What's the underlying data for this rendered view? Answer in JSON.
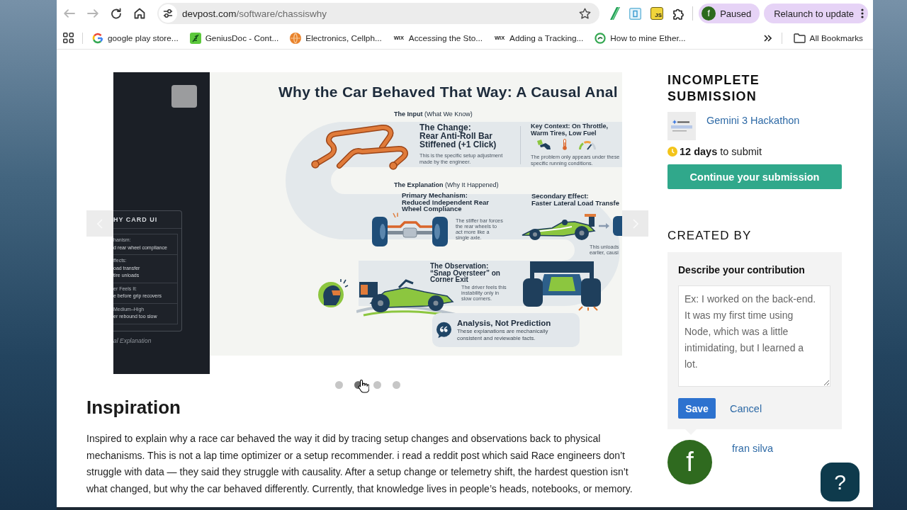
{
  "browser": {
    "nav_buttons": [
      {
        "kind": "back",
        "disabled": true
      },
      {
        "kind": "forward",
        "disabled": true
      },
      {
        "kind": "reload",
        "disabled": false
      },
      {
        "kind": "home",
        "disabled": false
      }
    ],
    "address_bar": {
      "host": "devpost.com",
      "path": "/software/chassiswhy"
    },
    "extensions": [
      {
        "kind": "pen"
      },
      {
        "kind": "frame"
      },
      {
        "kind": "js",
        "label": "JS"
      },
      {
        "kind": "puzzle"
      }
    ],
    "profile": {
      "initial": "f",
      "label": "Paused"
    },
    "update_button": {
      "label": "Relaunch to update"
    },
    "bookmarks": [
      {
        "kind": "google",
        "title": "google play store..."
      },
      {
        "kind": "leaf",
        "title": "GeniusDoc - Cont..."
      },
      {
        "kind": "globe",
        "title": "Electronics, Cellph..."
      },
      {
        "kind": "wix",
        "icon_text": "WIX",
        "title": "Accessing the Sto..."
      },
      {
        "kind": "wix",
        "icon_text": "WIX",
        "title": "Adding a Tracking..."
      },
      {
        "kind": "ring",
        "title": "How to mine Ether..."
      }
    ],
    "all_bookmarks": {
      "label": "All Bookmarks"
    }
  },
  "page": {
    "carousel": {
      "slide": {
        "side_panel": {
          "card_title": "HY CARD UI",
          "sections": [
            {
              "label": "hanism:",
              "lines": [
                "d rear wheel compliance"
              ]
            },
            {
              "label": "ffects:",
              "lines": [
                "oad transfer",
                "tire unloads"
              ]
            },
            {
              "label": "er Feels It:",
              "lines": [
                "e before grip recovers"
              ]
            },
            {
              "label": "Medium–High",
              "lines": [
                "er rebound too slow"
              ]
            }
          ],
          "footer": "al Explanation"
        },
        "infographic": {
          "title": "Why the Car Behaved That Way: A Causal Anal",
          "input_heading": "**The Input** (What We Know)",
          "change": {
            "label": "The Change:",
            "title": "Rear Anti-Roll Bar Stiffened (+1 Click)",
            "note": "This is the specific setup adjustment made by the engineer."
          },
          "context": {
            "title": "Key Context: On Throttle, Warm Tires, Low Fuel",
            "note": "The problem only appears under these specific running conditions."
          },
          "explanation_heading": "**The Explanation** (Why It Happened)",
          "mechanism": {
            "label": "Primary Mechanism:",
            "title": "Reduced Independent Rear Wheel Compliance",
            "note": "The stiffer bar forces the rear wheels to act more like a single axle."
          },
          "secondary": {
            "label": "Secondary Effect:",
            "title": "Faster Lateral Load Transfe",
            "note_lines": [
              "This unloads",
              "earlier, causi"
            ]
          },
          "observation": {
            "label": "The Observation:",
            "title": "“Snap Oversteer” on Corner Exit",
            "note": "The driver feels this instability only in slow corners."
          },
          "callout": {
            "title": "Analysis, Not Prediction",
            "text": "These explanations are mechanically consistent and reviewable facts."
          }
        }
      },
      "dots": [
        {
          "selected": false
        },
        {
          "selected": true
        },
        {
          "selected": false
        },
        {
          "selected": false
        }
      ]
    },
    "about": {
      "heading": "Inspiration",
      "paragraph": "Inspired to explain why a race car behaved the way it did by tracing setup changes and observations back to physical mechanisms. This is not a lap time optimizer or a setup recommender. i read a reddit post which said Race engineers don’t struggle with data — they said they struggle with causality. After a setup change or telemetry shift, the hardest question isn’t what changed, but why the car behaved differently. Currently, that knowledge lives in people’s heads, notebooks, or memory."
    },
    "sidebar": {
      "status_title": "INCOMPLETE SUBMISSION",
      "hackathon": {
        "name": "Gemini 3 Hackathon"
      },
      "deadline": "**12 days** to submit",
      "continue_button": "Continue your submission",
      "created_by_title": "CREATED BY",
      "contribution_form": {
        "label": "Describe your contribution",
        "placeholder": "Ex: I worked on the back-end. It was my first time using Node, which was a little intimidating, but I learned a lot.",
        "save": "Save",
        "cancel": "Cancel"
      },
      "member": {
        "initial": "f",
        "name": "fran silva"
      }
    },
    "help_button": {
      "label": "?"
    }
  }
}
